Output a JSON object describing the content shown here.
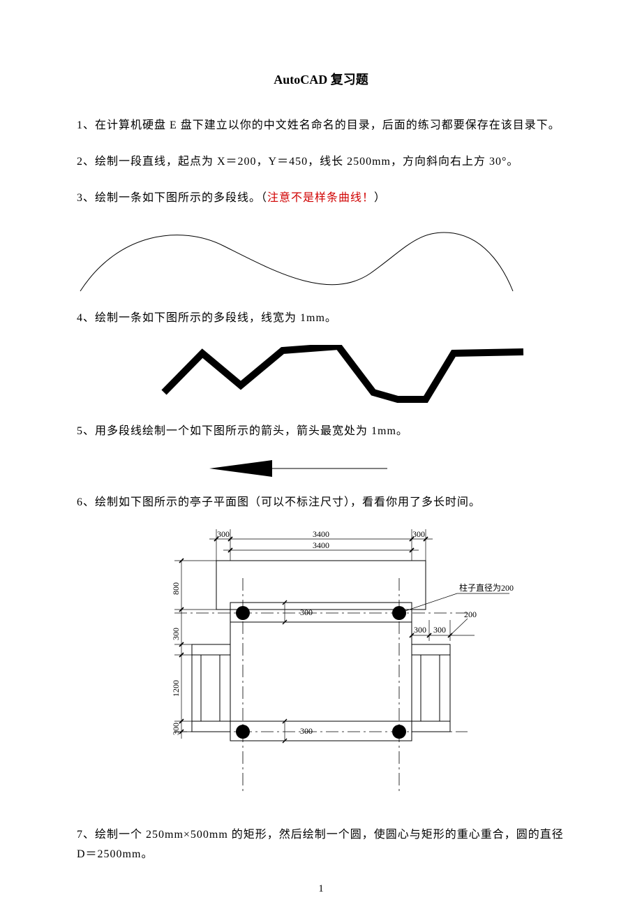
{
  "title": "AutoCAD 复习题",
  "items": {
    "q1": "1、在计算机硬盘 E 盘下建立以你的中文姓名命名的目录，后面的练习都要保存在该目录下。",
    "q2": "2、绘制一段直线，起点为 X＝200，Y＝450，线长 2500mm，方向斜向右上方 30°。",
    "q3_a": "3、绘制一条如下图所示的多段线。（",
    "q3_red": "注意不是样条曲线！",
    "q3_b": "）",
    "q4": "4、绘制一条如下图所示的多段线，线宽为 1mm。",
    "q5": "5、用多段线绘制一个如下图所示的箭头，箭头最宽处为 1mm。",
    "q6": "6、绘制如下图所示的亭子平面图（可以不标注尺寸），看看你用了多长时间。",
    "q7": "7、绘制一个 250mm×500mm 的矩形，然后绘制一个圆，使圆心与矩形的重心重合，圆的直径 D＝2500mm。"
  },
  "pavilion": {
    "dims": {
      "d300": "300",
      "d3400": "3400",
      "d800": "800",
      "d1200": "1200",
      "d200": "200"
    },
    "note": "柱子直径为200"
  },
  "page_number": "1"
}
